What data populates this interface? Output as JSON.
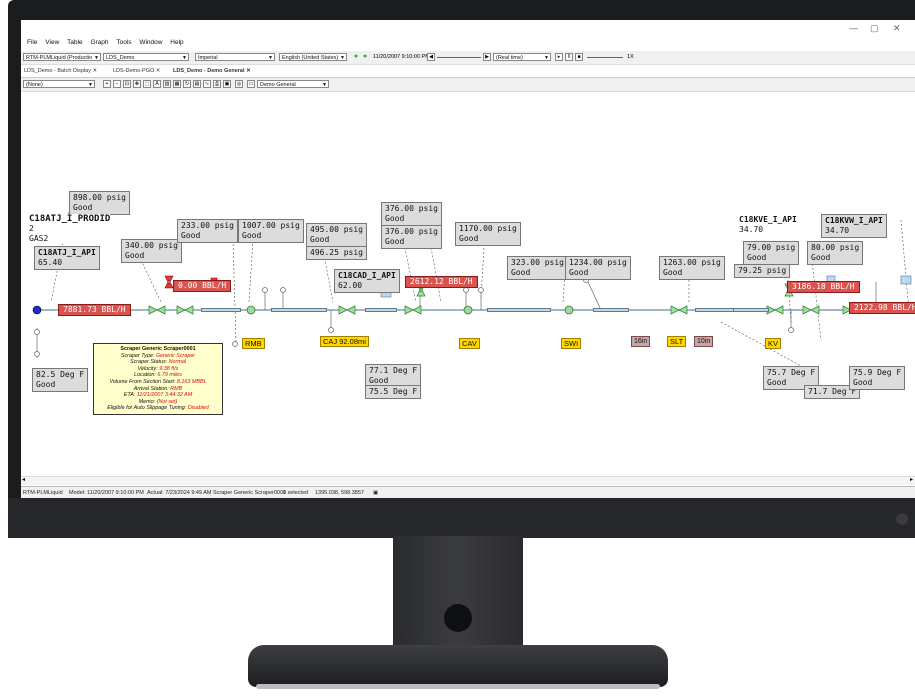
{
  "app": {
    "menu": [
      "File",
      "View",
      "Table",
      "Graph",
      "Tools",
      "Window",
      "Help"
    ],
    "window_controls": [
      "—",
      "▢",
      "✕"
    ]
  },
  "toolbar1": {
    "app_select": "RTM-PLMLiquid (Productio",
    "project_select": "LDS_Demo",
    "units_select": "Imperial",
    "locale_select": "English (United States)",
    "datetime": "11/20/2007 9:10:00 PM",
    "mode_select": "(Real time)",
    "speed": "1X"
  },
  "tabs": [
    {
      "label": "LDS_Demo - Batch Display"
    },
    {
      "label": "LDS-Demo-PGO"
    },
    {
      "label": "LDS_Demo - Demo General"
    }
  ],
  "toolbar2": {
    "layer_select": "(None)",
    "view_select": "Demo General"
  },
  "diagram": {
    "labels": {
      "p898": [
        "898.00 psig",
        "Good"
      ],
      "prodid": [
        "C18ATJ_I_PRODID",
        "2",
        "GAS2"
      ],
      "api_c18atj": [
        "C18ATJ_I_API",
        "65.40"
      ],
      "p340": [
        "340.00 psig",
        "Good"
      ],
      "p233": [
        "233.00 psig",
        "Good"
      ],
      "p1007": [
        "1007.00 psig",
        "Good"
      ],
      "p495": [
        "495.00 psig",
        "Good"
      ],
      "p496": [
        "496.25 psig"
      ],
      "p376a": [
        "376.00 psig",
        "Good"
      ],
      "p376b": [
        "376.00 psig",
        "Good"
      ],
      "p1170": [
        "1170.00 psig",
        "Good"
      ],
      "api_c18cad": [
        "C18CAD_I_API",
        "62.00"
      ],
      "p323": [
        "323.00 psig",
        "Good"
      ],
      "p1234": [
        "1234.00 psig",
        "Good"
      ],
      "p1263": [
        "1263.00 psig",
        "Good"
      ],
      "api_c18kve": [
        "C18KVE_I_API",
        "34.70"
      ],
      "p79": [
        "79.00 psig",
        "Good"
      ],
      "p79_25": [
        "79.25 psig"
      ],
      "p80": [
        "80.00 psig",
        "Good"
      ],
      "api_c18kvw": [
        "C18KVW_I_API",
        "34.70"
      ],
      "t82": [
        "82.5 Deg F",
        "Good"
      ],
      "t77": [
        "77.1 Deg F",
        "Good"
      ],
      "t75_5": [
        "75.5 Deg F"
      ],
      "t75_7": [
        "75.7 Deg F",
        "Good"
      ],
      "t71_7": [
        "71.7 Deg F"
      ],
      "t75_9": [
        "75.9 Deg F",
        "Good"
      ]
    },
    "flows": {
      "f7881": "7881.73 BBL/H",
      "f0": "0.00 BBL/H",
      "f2612": "2612.12 BBL/H",
      "f3186": "3186.18 BBL/H",
      "f2122": "2122.98 BBL/H"
    },
    "stations": {
      "rmb": "RMB",
      "caj": "CAJ 92.08mi",
      "cav": "CAV",
      "swi": "SWI",
      "slt": "SLT",
      "kv": "KV"
    },
    "pipe_sizes": {
      "a": "16in",
      "b": "10in"
    }
  },
  "popup": {
    "title": "Scraper Generic Scraper0001",
    "rows": [
      {
        "k": "Scraper Type:",
        "v": "Generic Scraper"
      },
      {
        "k": "Scraper Status:",
        "v": "Normal"
      },
      {
        "k": "Velocity:",
        "v": "9.38 ft/s"
      },
      {
        "k": "Location:",
        "v": "6.79 miles"
      },
      {
        "k": "Volume From Section Start:",
        "v": "8.163 MBBL"
      },
      {
        "k": "Arrival Station:",
        "v": "RMB"
      },
      {
        "k": "ETA:",
        "v": "11/21/2007 3:44:32 AM"
      },
      {
        "k": "Memo:",
        "v": "(Not set)"
      },
      {
        "k": "Eligible for Auto Slippage Tuning:",
        "v": "Disabled"
      }
    ]
  },
  "status": {
    "app": "RTM-PLMLiquid",
    "model": "Model: 11/20/2007 9:10:00 PM",
    "actual": "Actual: 7/23/2024 9:49 AM",
    "selected_item": "Scraper Generic Scraper0001",
    "selected_count": "0 selected",
    "coords": "1395.038, 598.3857"
  },
  "colors": {
    "flow_bg": "#d9534f",
    "station_bg": "#ffd600",
    "label_bg": "#dcdcdc",
    "pipe": "#c9d6de"
  }
}
